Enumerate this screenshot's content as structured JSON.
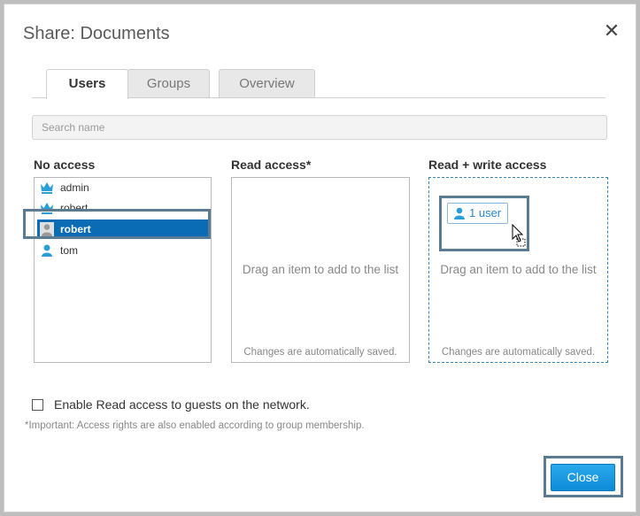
{
  "dialog": {
    "title": "Share: Documents",
    "close_glyph": "✕"
  },
  "tabs": [
    {
      "label": "Users",
      "active": true
    },
    {
      "label": "Groups",
      "active": false
    },
    {
      "label": "Overview",
      "active": false
    }
  ],
  "search": {
    "placeholder": "Search name",
    "value": ""
  },
  "columns": {
    "no_access": {
      "title": "No access",
      "items": [
        {
          "label": "admin",
          "icon": "admin-crown-icon"
        },
        {
          "label": "robert",
          "icon": "admin-crown-icon"
        },
        {
          "label": "robert",
          "icon": "user-icon",
          "selected": true
        },
        {
          "label": "tom",
          "icon": "user-icon"
        }
      ]
    },
    "read_access": {
      "title": "Read access*",
      "hint": "Drag an item to add to the list",
      "saved": "Changes are automatically saved."
    },
    "read_write_access": {
      "title": "Read + write access",
      "hint": "Drag an item to add to the list",
      "saved": "Changes are automatically saved.",
      "drag_chip": "1 user"
    }
  },
  "guest_option": {
    "label": "Enable Read access to guests on the network.",
    "checked": false
  },
  "note": "*Important: Access rights are also enabled according to group membership.",
  "footer": {
    "close_label": "Close"
  },
  "colors": {
    "accent": "#0a6cb5",
    "button": "#1a9ae0",
    "highlight_frame": "#5a7b92",
    "crown": "#2a9fd6"
  }
}
